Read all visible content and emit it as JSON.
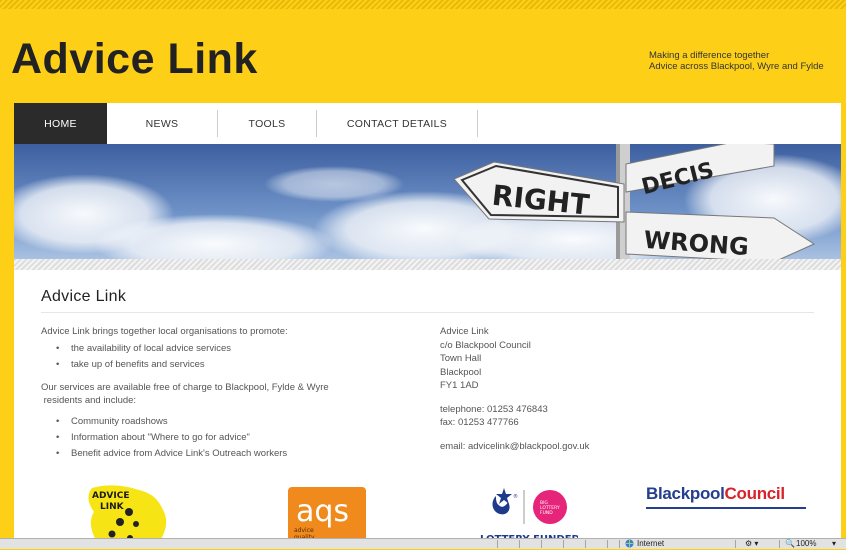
{
  "site": {
    "title": "Advice Link",
    "tagline_line1": "Making a difference together",
    "tagline_line2": "Advice across Blackpool, Wyre and Fylde"
  },
  "nav": {
    "items": [
      {
        "label": "HOME"
      },
      {
        "label": "NEWS"
      },
      {
        "label": "TOOLS"
      },
      {
        "label": "CONTACT DETAILS"
      }
    ]
  },
  "banner": {
    "sign_right": "RIGHT",
    "sign_wrong": "WRONG",
    "sign_decis": "DECIS"
  },
  "content": {
    "heading": "Advice Link",
    "intro": "Advice Link brings together local organisations to promote:",
    "promote_items": [
      "the availability of local advice services",
      "take up of benefits and services"
    ],
    "services_line1": "Our services are available free of charge to Blackpool, Fylde & Wyre",
    "services_line2": " residents and include:",
    "service_items": [
      "Community roadshows",
      "Information about \"Where to go for advice\"",
      "Benefit advice from Advice Link's Outreach workers"
    ],
    "address": [
      "Advice Link",
      "c/o Blackpool Council",
      "Town Hall",
      "Blackpool",
      "FY1 1AD"
    ],
    "telephone": "telephone: 01253 476843",
    "fax": "fax: 01253 477766",
    "email": "email: advicelink@blackpool.gov.uk"
  },
  "logos": {
    "advicelink_line1": "ADVICE",
    "advicelink_line2": "LINK",
    "aqs_text": "aqs",
    "aqs_sub1": "advice",
    "aqs_sub2": "quality",
    "lottery_pink1": "BIG",
    "lottery_pink2": "LOTTERY",
    "lottery_pink3": "FUND",
    "lottery_funded": "LOTTERY FUNDED",
    "blackpool_part1": "Blackpool",
    "blackpool_part2": "Council"
  },
  "statusbar": {
    "zone": "Internet",
    "zoom": "100%"
  },
  "colors": {
    "brand_yellow": "#fdd017",
    "nav_active": "#2b2b2b",
    "blackpool_blue": "#243e90",
    "blackpool_red": "#d8232a",
    "lottery_pink": "#e5247a",
    "aqs_orange": "#f08a1c"
  }
}
